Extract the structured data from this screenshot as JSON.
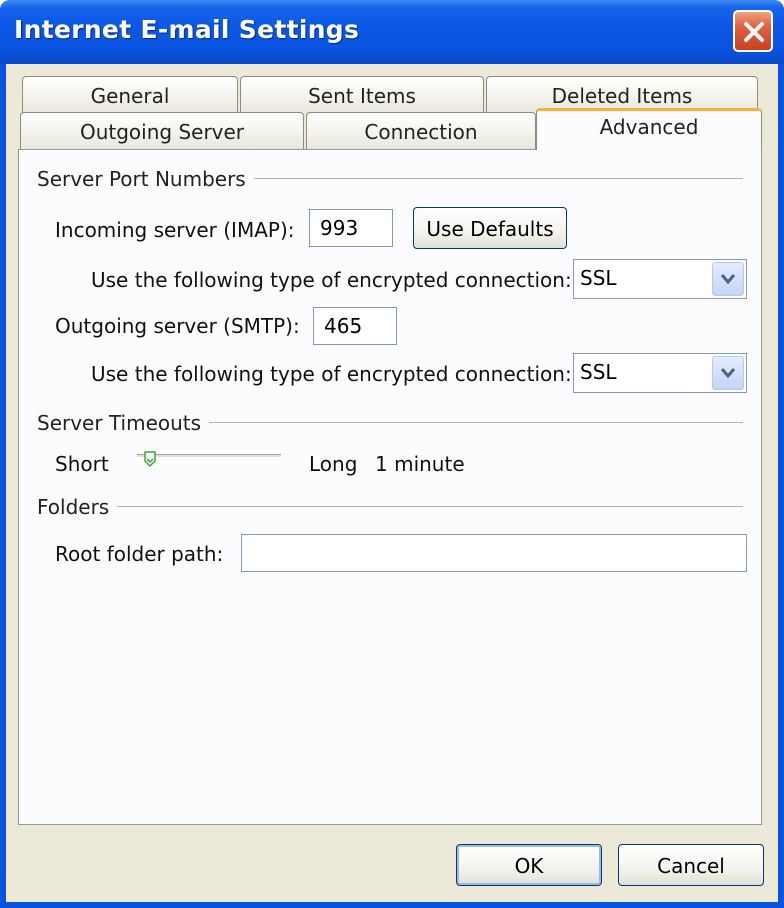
{
  "window": {
    "title": "Internet E-mail Settings"
  },
  "tabs": {
    "row1": [
      {
        "label": "General"
      },
      {
        "label": "Sent Items"
      },
      {
        "label": "Deleted Items"
      }
    ],
    "row2": [
      {
        "label": "Outgoing Server"
      },
      {
        "label": "Connection"
      },
      {
        "label": "Advanced",
        "active": true
      }
    ]
  },
  "ports": {
    "group_title": "Server Port Numbers",
    "incoming_label": "Incoming server (IMAP):",
    "incoming_value": "993",
    "use_defaults_label": "Use Defaults",
    "incoming_enc_label": "Use the following type of encrypted connection:",
    "incoming_enc_value": "SSL",
    "outgoing_label": "Outgoing server (SMTP):",
    "outgoing_value": "465",
    "outgoing_enc_label": "Use the following type of encrypted connection:",
    "outgoing_enc_value": "SSL"
  },
  "timeouts": {
    "group_title": "Server Timeouts",
    "short_label": "Short",
    "long_label": "Long",
    "value_text": "1 minute",
    "slider_level": 0.05
  },
  "folders": {
    "group_title": "Folders",
    "root_label": "Root folder path:",
    "root_value": ""
  },
  "footer": {
    "ok_label": "OK",
    "cancel_label": "Cancel"
  },
  "colors": {
    "title_bar": "#0a55e2",
    "dialog_bg": "#ece9d8",
    "active_tab_accent": "#f6b33a",
    "close_button": "#e06040",
    "slider_thumb": "#3aa83a"
  }
}
